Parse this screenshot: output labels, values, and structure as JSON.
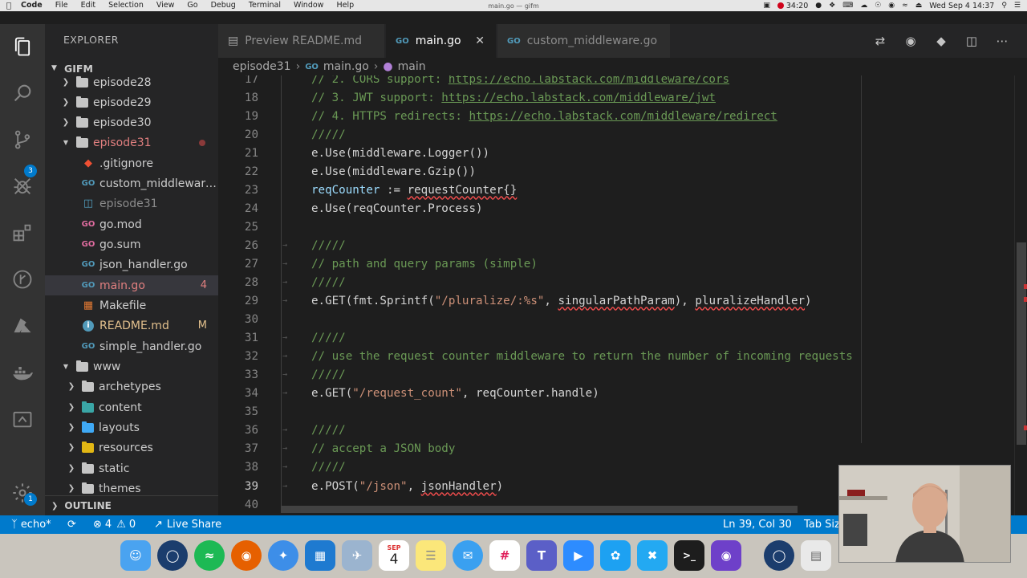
{
  "menubar": {
    "app_name": "Code",
    "items": [
      "File",
      "Edit",
      "Selection",
      "View",
      "Go",
      "Debug",
      "Terminal",
      "Window",
      "Help"
    ],
    "window_title": "main.go — gifm",
    "recording_time": "34:20",
    "clock": "Wed Sep 4  14:37"
  },
  "activity_bar": {
    "scm_badge": "3",
    "settings_badge": "1"
  },
  "sidebar": {
    "title": "EXPLORER",
    "root": "GIFM",
    "items": [
      {
        "label": "episode28",
        "type": "folder",
        "icon": "folder-icon"
      },
      {
        "label": "episode29",
        "type": "folder",
        "icon": "folder-icon"
      },
      {
        "label": "episode30",
        "type": "folder",
        "icon": "folder-icon"
      },
      {
        "label": "episode31",
        "type": "folder-open",
        "icon": "folder-open-icon"
      },
      {
        "label": ".gitignore",
        "type": "file",
        "icon": "git-icon"
      },
      {
        "label": "custom_middleware....",
        "type": "file",
        "icon": "go-file-icon"
      },
      {
        "label": "episode31",
        "type": "file",
        "icon": "file-icon"
      },
      {
        "label": "go.mod",
        "type": "file",
        "icon": "go-file-icon"
      },
      {
        "label": "go.sum",
        "type": "file",
        "icon": "go-file-icon"
      },
      {
        "label": "json_handler.go",
        "type": "file",
        "icon": "go-file-icon"
      },
      {
        "label": "main.go",
        "type": "file",
        "icon": "go-file-icon",
        "badge": "4"
      },
      {
        "label": "Makefile",
        "type": "file",
        "icon": "makefile-icon"
      },
      {
        "label": "README.md",
        "type": "file",
        "icon": "info-icon",
        "badge": "M"
      },
      {
        "label": "simple_handler.go",
        "type": "file",
        "icon": "go-file-icon"
      },
      {
        "label": "www",
        "type": "folder-open",
        "icon": "folder-open-icon"
      },
      {
        "label": "archetypes",
        "type": "folder",
        "icon": "folder-icon"
      },
      {
        "label": "content",
        "type": "folder",
        "icon": "folder-icon"
      },
      {
        "label": "layouts",
        "type": "folder",
        "icon": "folder-icon"
      },
      {
        "label": "resources",
        "type": "folder",
        "icon": "folder-icon"
      },
      {
        "label": "static",
        "type": "folder",
        "icon": "folder-icon"
      },
      {
        "label": "themes",
        "type": "folder",
        "icon": "folder-icon"
      }
    ],
    "outline_title": "OUTLINE"
  },
  "tabs": [
    {
      "label": "Preview README.md",
      "icon": "preview-icon"
    },
    {
      "label": "main.go",
      "icon": "go-file-icon",
      "active": true
    },
    {
      "label": "custom_middleware.go",
      "icon": "go-file-icon"
    }
  ],
  "breadcrumb": {
    "folder": "episode31",
    "file": "main.go",
    "symbol": "main"
  },
  "editor": {
    "lines": [
      {
        "n": "17",
        "text": "// 2. CORS support: https://echo.labstack.com/middleware/cors"
      },
      {
        "n": "18",
        "text": "// 3. JWT support: https://echo.labstack.com/middleware/jwt"
      },
      {
        "n": "19",
        "text": "// 4. HTTPS redirects: https://echo.labstack.com/middleware/redirect"
      },
      {
        "n": "20",
        "text": "/////"
      },
      {
        "n": "21",
        "text": "e.Use(middleware.Logger())"
      },
      {
        "n": "22",
        "text": "e.Use(middleware.Gzip())"
      },
      {
        "n": "23",
        "text": "reqCounter := requestCounter{}"
      },
      {
        "n": "24",
        "text": "e.Use(reqCounter.Process)"
      },
      {
        "n": "25",
        "text": ""
      },
      {
        "n": "26",
        "text": "/////"
      },
      {
        "n": "27",
        "text": "// path and query params (simple)"
      },
      {
        "n": "28",
        "text": "/////"
      },
      {
        "n": "29",
        "text": "e.GET(fmt.Sprintf(\"/pluralize/:%s\", singularPathParam), pluralizeHandler)"
      },
      {
        "n": "30",
        "text": ""
      },
      {
        "n": "31",
        "text": "/////"
      },
      {
        "n": "32",
        "text": "// use the request counter middleware to return the number of incoming requests"
      },
      {
        "n": "33",
        "text": "/////"
      },
      {
        "n": "34",
        "text": "e.GET(\"/request_count\", reqCounter.handle)"
      },
      {
        "n": "35",
        "text": ""
      },
      {
        "n": "36",
        "text": "/////"
      },
      {
        "n": "37",
        "text": "// accept a JSON body"
      },
      {
        "n": "38",
        "text": "/////"
      },
      {
        "n": "39",
        "text": "e.POST(\"/json\", jsonHandler)"
      },
      {
        "n": "40",
        "text": ""
      }
    ],
    "segments": {
      "l17a": "// 2. CORS support: ",
      "l17b": "https://echo.labstack.com/middleware/cors",
      "l18a": "// 3. JWT support: ",
      "l18b": "https://echo.labstack.com/middleware/jwt",
      "l19a": "// 4. HTTPS redirects: ",
      "l19b": "https://echo.labstack.com/middleware/redirect",
      "l20": "/////",
      "l21": "e.Use(middleware.Logger())",
      "l22": "e.Use(middleware.Gzip())",
      "l23a": "reqCounter",
      "l23b": " := ",
      "l23c": "requestCounter{}",
      "l24": "e.Use(reqCounter.Process)",
      "l26": "/////",
      "l27": "// path and query params (simple)",
      "l28": "/////",
      "l29a": "e.GET(fmt.Sprintf(",
      "l29b": "\"/pluralize/:%s\"",
      "l29c": ", ",
      "l29d": "singularPathParam",
      "l29e": "), ",
      "l29f": "pluralizeHandler",
      "l29g": ")",
      "l31": "/////",
      "l32": "// use the request counter middleware to return the number of incoming requests",
      "l33": "/////",
      "l34a": "e.GET(",
      "l34b": "\"/request_count\"",
      "l34c": ", reqCounter.handle)",
      "l36": "/////",
      "l37": "// accept a JSON body",
      "l38": "/////",
      "l39a": "e.POST(",
      "l39b": "\"/json\"",
      "l39c": ", ",
      "l39d": "jsonHandler",
      "l39e": ")"
    }
  },
  "statusbar": {
    "branch": "echo*",
    "errors": "4",
    "warnings": "0",
    "live_share": "Live Share",
    "cursor": "Ln 39, Col 30",
    "tab_size": "Tab Siz"
  },
  "dock": {
    "calendar_month": "SEP",
    "calendar_day": "4"
  },
  "colors": {
    "accent": "#007acc",
    "comment": "#6a9955",
    "string": "#ce9178",
    "error": "#f14c4c",
    "go_icon": "#519aba",
    "modified": "#e2c08d"
  }
}
